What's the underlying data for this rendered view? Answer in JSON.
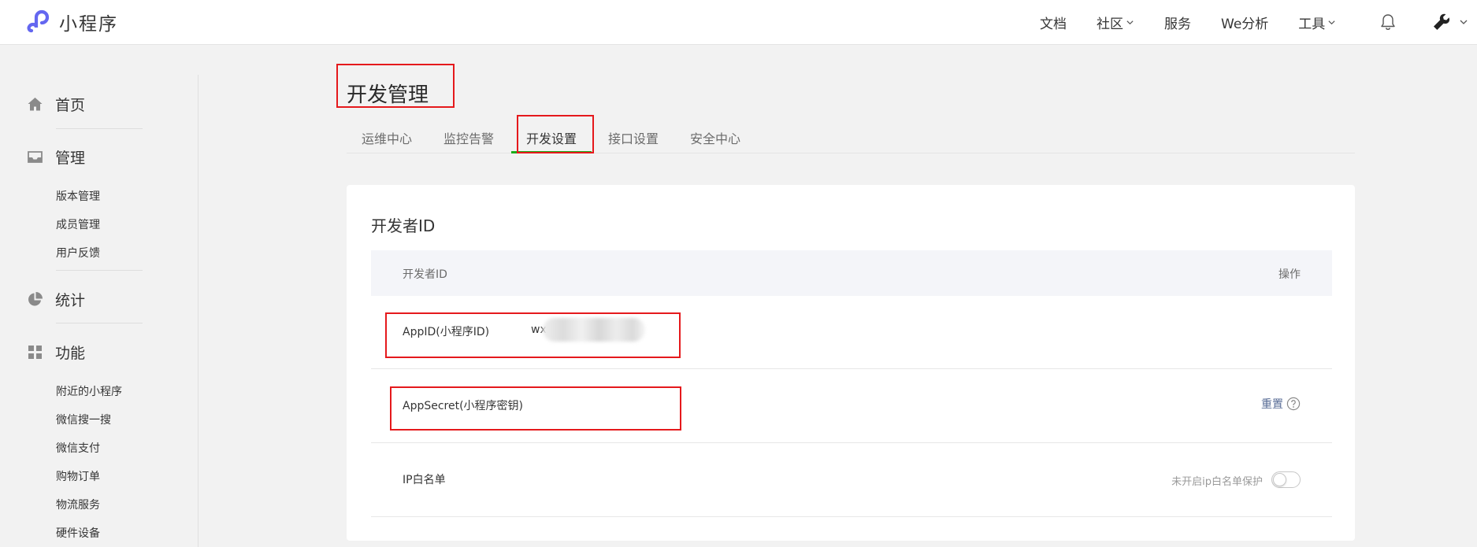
{
  "header": {
    "brand": "小程序",
    "nav": [
      {
        "label": "文档",
        "has_menu": false
      },
      {
        "label": "社区",
        "has_menu": true
      },
      {
        "label": "服务",
        "has_menu": false
      },
      {
        "label": "We分析",
        "has_menu": false
      },
      {
        "label": "工具",
        "has_menu": true
      }
    ],
    "icons": [
      "bell-icon",
      "wrench-icon"
    ]
  },
  "sidebar": {
    "groups": [
      {
        "label": "首页",
        "icon": "home-icon"
      },
      {
        "label": "管理",
        "icon": "inbox-icon",
        "items": [
          "版本管理",
          "成员管理",
          "用户反馈"
        ]
      },
      {
        "label": "统计",
        "icon": "pie-chart-icon"
      },
      {
        "label": "功能",
        "icon": "grid-icon",
        "items": [
          "附近的小程序",
          "微信搜一搜",
          "微信支付",
          "购物订单",
          "物流服务",
          "硬件设备"
        ]
      }
    ]
  },
  "main": {
    "title": "开发管理",
    "tabs": [
      {
        "label": "运维中心",
        "active": false
      },
      {
        "label": "监控告警",
        "active": false
      },
      {
        "label": "开发设置",
        "active": true
      },
      {
        "label": "接口设置",
        "active": false
      },
      {
        "label": "安全中心",
        "active": false
      }
    ],
    "card": {
      "title": "开发者ID",
      "columns": [
        "开发者ID",
        "操作"
      ],
      "rows": [
        {
          "label": "AppID(小程序ID)",
          "value": "wx"
        },
        {
          "label": "AppSecret(小程序密钥)",
          "action": "重置"
        },
        {
          "label": "IP白名单",
          "status": "未开启ip白名单保护",
          "toggle_on": false
        }
      ]
    }
  },
  "colors": {
    "accent_green": "#1aad19",
    "link_blue": "#576b95",
    "highlight_red": "#e5191c",
    "logo_purple": "#6467f0"
  }
}
